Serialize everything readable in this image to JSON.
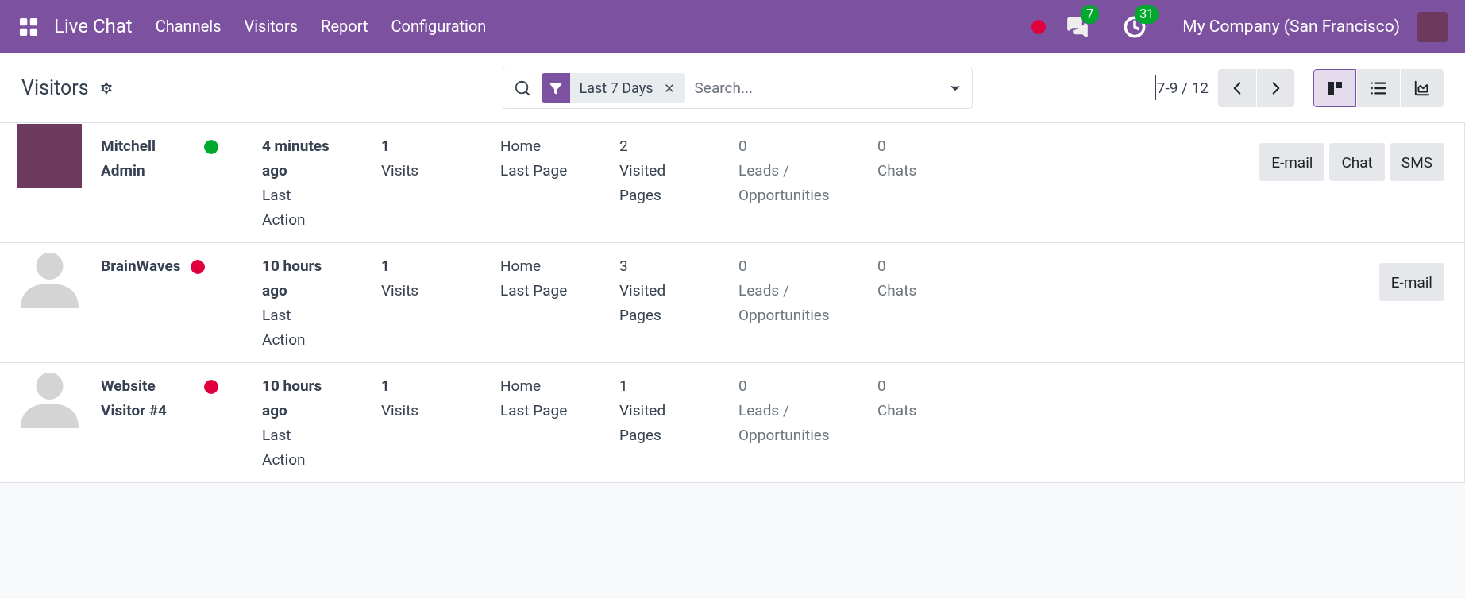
{
  "navbar": {
    "app": "Live Chat",
    "menu": [
      "Channels",
      "Visitors",
      "Report",
      "Configuration"
    ],
    "messages_count": "7",
    "activities_count": "31",
    "company": "My Company (San Francisco)"
  },
  "control_panel": {
    "title": "Visitors",
    "facet": "Last 7 Days",
    "search": {
      "placeholder": "Search..."
    },
    "pager": "7-9 / 12",
    "views": [
      {
        "kind": "kanban",
        "selected": true
      },
      {
        "kind": "list",
        "selected": false
      },
      {
        "kind": "graph",
        "selected": false
      }
    ]
  },
  "visitors": [
    {
      "name": "Mitchell Admin",
      "kind": "photo",
      "color": "#00a82d",
      "last_action": "4 minutes ago",
      "last_action_label": "Last Action",
      "visits": "1",
      "visits_label": "Visits",
      "last_page": "Home",
      "last_page_label": "Last Page",
      "pages": "2",
      "pages_label": "Visited Pages",
      "leads": "0",
      "leads_label": "Leads / Opportunities",
      "chats": "0",
      "chats_label": "Chats",
      "buttons": [
        "E-mail",
        "Chat",
        "SMS"
      ]
    },
    {
      "name": "BrainWaves",
      "kind": "default",
      "color": "#e0003d",
      "last_action": "10 hours ago",
      "last_action_label": "Last Action",
      "visits": "1",
      "visits_label": "Visits",
      "last_page": "Home",
      "last_page_label": "Last Page",
      "pages": "3",
      "pages_label": "Visited Pages",
      "leads": "0",
      "leads_label": "Leads / Opportunities",
      "chats": "0",
      "chats_label": "Chats",
      "buttons": [
        "E-mail"
      ]
    },
    {
      "name": "Website Visitor #4",
      "kind": "default",
      "color": "#e0003d",
      "last_action": "10 hours ago",
      "last_action_label": "Last Action",
      "visits": "1",
      "visits_label": "Visits",
      "last_page": "Home",
      "last_page_label": "Last Page",
      "pages": "1",
      "pages_label": "Visited Pages",
      "leads": "0",
      "leads_label": "Leads / Opportunities",
      "chats": "0",
      "chats_label": "Chats"
    }
  ]
}
